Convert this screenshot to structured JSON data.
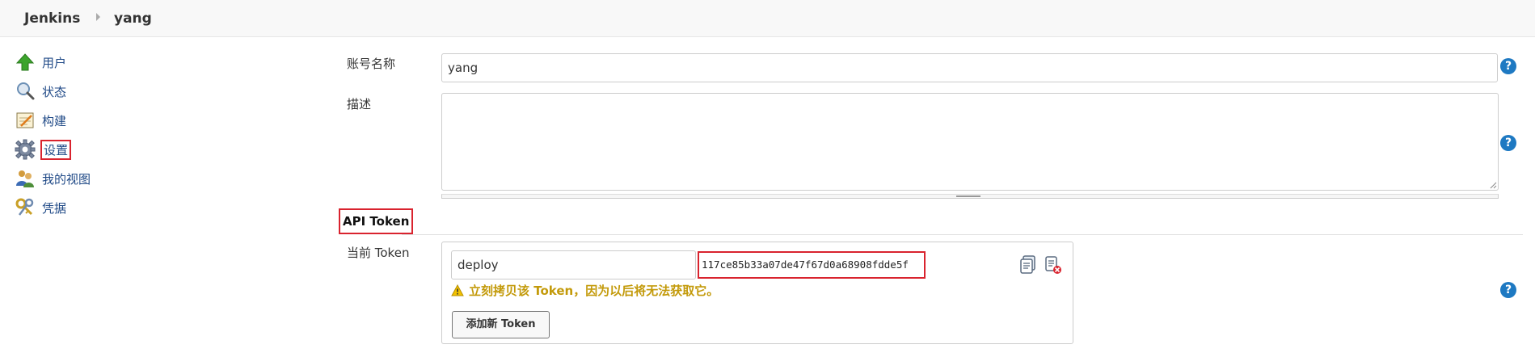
{
  "breadcrumb": {
    "root": "Jenkins",
    "user": "yang"
  },
  "sidebar": {
    "items": [
      {
        "label": "用户",
        "icon": "up-arrow-icon"
      },
      {
        "label": "状态",
        "icon": "magnifier-icon"
      },
      {
        "label": "构建",
        "icon": "notepad-icon"
      },
      {
        "label": "设置",
        "icon": "gear-icon"
      },
      {
        "label": "我的视图",
        "icon": "people-icon"
      },
      {
        "label": "凭据",
        "icon": "keys-icon"
      }
    ]
  },
  "form": {
    "account_name_label": "账号名称",
    "account_name_value": "yang",
    "description_label": "描述",
    "description_value": ""
  },
  "api_token": {
    "section_title": "API Token",
    "current_label": "当前 Token",
    "token_name": "deploy",
    "token_value": "117ce85b33a07de47f67d0a68908fdde5f",
    "warning": "立刻拷贝该 Token，因为以后将无法获取它。",
    "add_button": "添加新 Token"
  },
  "colors": {
    "highlight_red": "#d9232e",
    "link_blue": "#204a87",
    "help_blue": "#1e79c2",
    "warning_gold": "#c39a0a"
  }
}
